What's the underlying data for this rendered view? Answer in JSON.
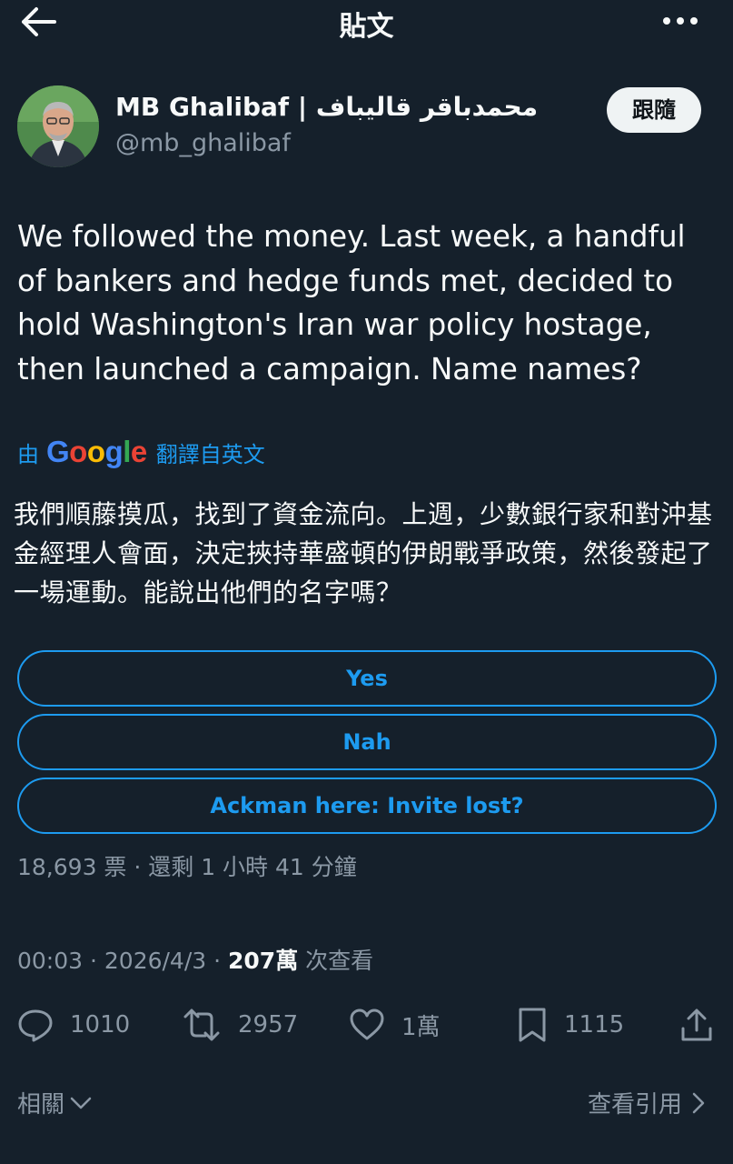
{
  "header": {
    "title": "貼文",
    "back_icon": "arrow-left-icon",
    "more_icon": "more-horizontal-icon"
  },
  "author": {
    "display_name": "MB Ghalibaf | محمدباقر قالیباف",
    "handle": "@mb_ghalibaf",
    "follow_label": "跟隨"
  },
  "tweet": {
    "text": "We followed the money. Last week, a handful of bankers and hedge funds met, decided to hold Washington's Iran war policy hostage, then launched a campaign. Name names?",
    "translation_prefix": "由",
    "translation_brand": "Google",
    "translation_suffix": "翻譯自英文",
    "translated_text": "我們順藤摸瓜，找到了資金流向。上週，少數銀行家和對沖基金經理人會面，決定挾持華盛頓的伊朗戰爭政策，然後發起了一場運動。能說出他們的名字嗎？"
  },
  "poll": {
    "options": [
      "Yes",
      "Nah",
      "Ackman here: Invite lost?"
    ],
    "votes_text": "18,693 票 · 還剩 1 小時 41 分鐘"
  },
  "meta": {
    "time_date": "00:03 · 2026/4/3 · ",
    "views_count": "207萬",
    "views_label": " 次查看"
  },
  "actions": {
    "replies": "1010",
    "retweets": "2957",
    "likes": "1萬",
    "bookmarks": "1115"
  },
  "footer": {
    "related_label": "相關",
    "quotes_label": "查看引用"
  },
  "colors": {
    "background": "#15202b",
    "accent": "#1d9bf0",
    "secondary_text": "#8b98a5"
  }
}
